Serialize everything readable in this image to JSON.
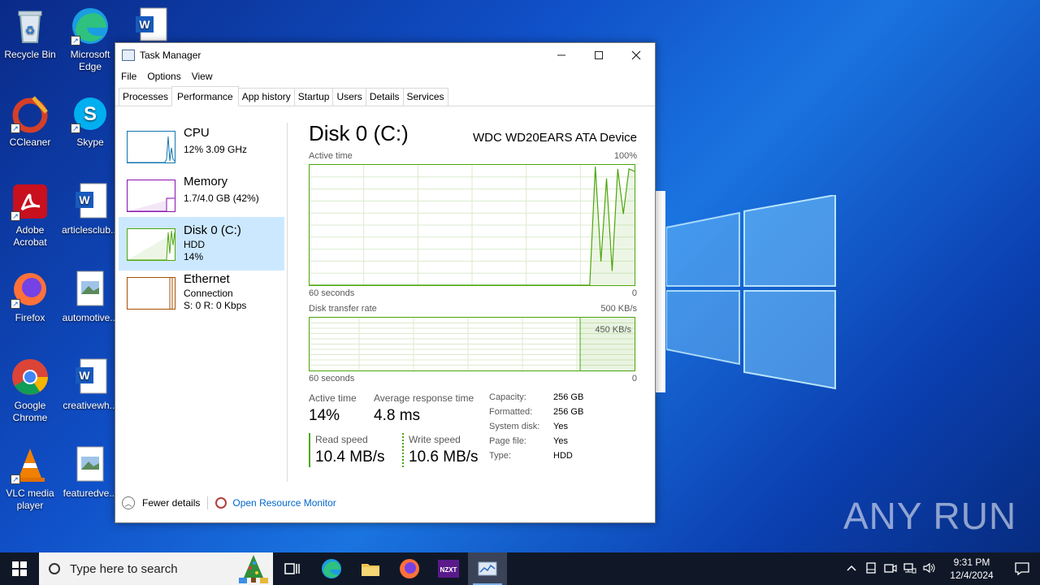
{
  "desktop": {
    "icons": [
      {
        "label": "Recycle Bin"
      },
      {
        "label": "Microsoft Edge"
      },
      {
        "label": ""
      },
      {
        "label": "CCleaner"
      },
      {
        "label": "Skype"
      },
      {
        "label": "Adobe Acrobat"
      },
      {
        "label": "articlesclub..."
      },
      {
        "label": "Firefox"
      },
      {
        "label": "automotive..."
      },
      {
        "label": "Google Chrome"
      },
      {
        "label": "creativewh..."
      },
      {
        "label": "VLC media player"
      },
      {
        "label": "featuredve..."
      }
    ],
    "watermark": "ANY RUN"
  },
  "window": {
    "title": "Task Manager",
    "menu": [
      "File",
      "Options",
      "View"
    ],
    "tabs": [
      "Processes",
      "Performance",
      "App history",
      "Startup",
      "Users",
      "Details",
      "Services"
    ],
    "active_tab": "Performance"
  },
  "sidebar": {
    "items": [
      {
        "name": "CPU",
        "sub1": "12%  3.09 GHz",
        "sub2": "",
        "color": "#1176ae"
      },
      {
        "name": "Memory",
        "sub1": "1.7/4.0 GB (42%)",
        "sub2": "",
        "color": "#8b12ae"
      },
      {
        "name": "Disk 0 (C:)",
        "sub1": "HDD",
        "sub2": "14%",
        "color": "#4da60c"
      },
      {
        "name": "Ethernet",
        "sub1": "Connection",
        "sub2": "S: 0  R: 0 Kbps",
        "color": "#a74f01"
      }
    ]
  },
  "detail": {
    "title": "Disk 0 (C:)",
    "model": "WDC WD20EARS ATA Device",
    "active_time_label": "Active time",
    "active_time_max": "100%",
    "axis_left": "60 seconds",
    "axis_right": "0",
    "transfer_label": "Disk transfer rate",
    "transfer_max": "500 KB/s",
    "transfer_marker": "450 KB/s",
    "active_time_series": [
      0,
      0,
      0,
      0,
      0,
      0,
      0,
      0,
      0,
      0,
      0,
      0,
      0,
      0,
      0,
      0,
      0,
      0,
      0,
      0,
      0,
      0,
      0,
      0,
      0,
      0,
      0,
      0,
      0,
      0,
      0,
      0,
      0,
      0,
      0,
      0,
      0,
      0,
      0,
      0,
      0,
      0,
      0,
      0,
      0,
      0,
      0,
      0,
      0,
      0,
      0,
      100,
      20,
      90,
      12,
      98,
      60,
      98,
      96
    ],
    "stats": {
      "active_time": {
        "label": "Active time",
        "value": "14%"
      },
      "avg_response": {
        "label": "Average response time",
        "value": "4.8 ms"
      },
      "read": {
        "label": "Read speed",
        "value": "10.4 MB/s"
      },
      "write": {
        "label": "Write speed",
        "value": "10.6 MB/s"
      }
    },
    "properties": [
      {
        "key": "Capacity:",
        "value": "256 GB"
      },
      {
        "key": "Formatted:",
        "value": "256 GB"
      },
      {
        "key": "System disk:",
        "value": "Yes"
      },
      {
        "key": "Page file:",
        "value": "Yes"
      },
      {
        "key": "Type:",
        "value": "HDD"
      }
    ]
  },
  "footer": {
    "fewer_details": "Fewer details",
    "open_resource_monitor": "Open Resource Monitor"
  },
  "taskbar": {
    "search_placeholder": "Type here to search",
    "time": "9:31 PM",
    "date": "12/4/2024"
  }
}
